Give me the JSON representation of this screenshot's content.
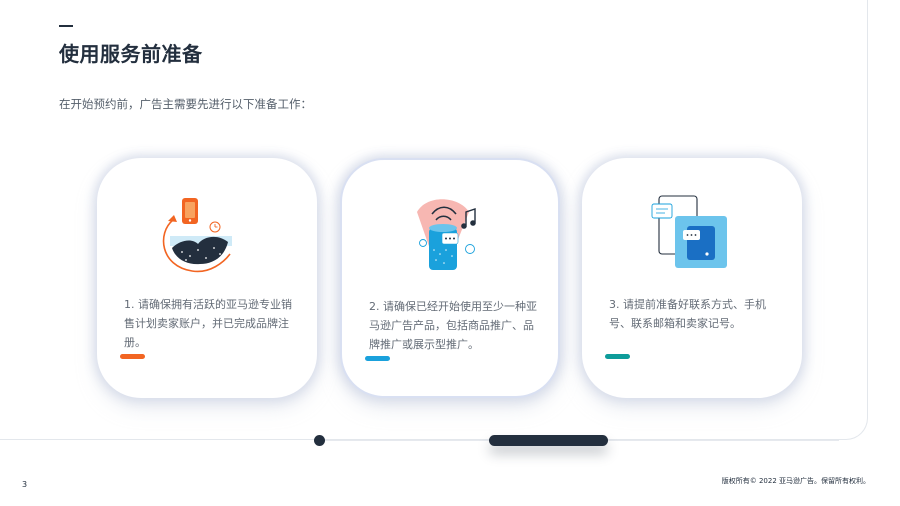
{
  "page": {
    "title": "使用服务前准备",
    "subtitle": "在开始预约前，广告主需要先进行以下准备工作：",
    "page_number": "3",
    "copyright": "版权所有© 2022 亚马逊广告。保留所有权利。"
  },
  "cards": [
    {
      "text": "1. 请确保拥有活跃的亚马逊专业销售计划卖家账户，并已完成品牌注册。",
      "accent_color": "#f26522",
      "icon": "phone-rising-chart-icon"
    },
    {
      "text": "2. 请确保已经开始使用至少一种亚马逊广告产品，包括商品推广、品牌推广或展示型推广。",
      "accent_color": "#1aa1dc",
      "icon": "smart-speaker-icon"
    },
    {
      "text": "3. 请提前准备好联系方式、手机号、联系邮箱和卖家记号。",
      "accent_color": "#0e9c9a",
      "icon": "phone-chat-icon"
    }
  ],
  "colors": {
    "dark": "#232f3e",
    "orange": "#f26522",
    "blue": "#1aa1dc",
    "teal": "#0e9c9a"
  }
}
